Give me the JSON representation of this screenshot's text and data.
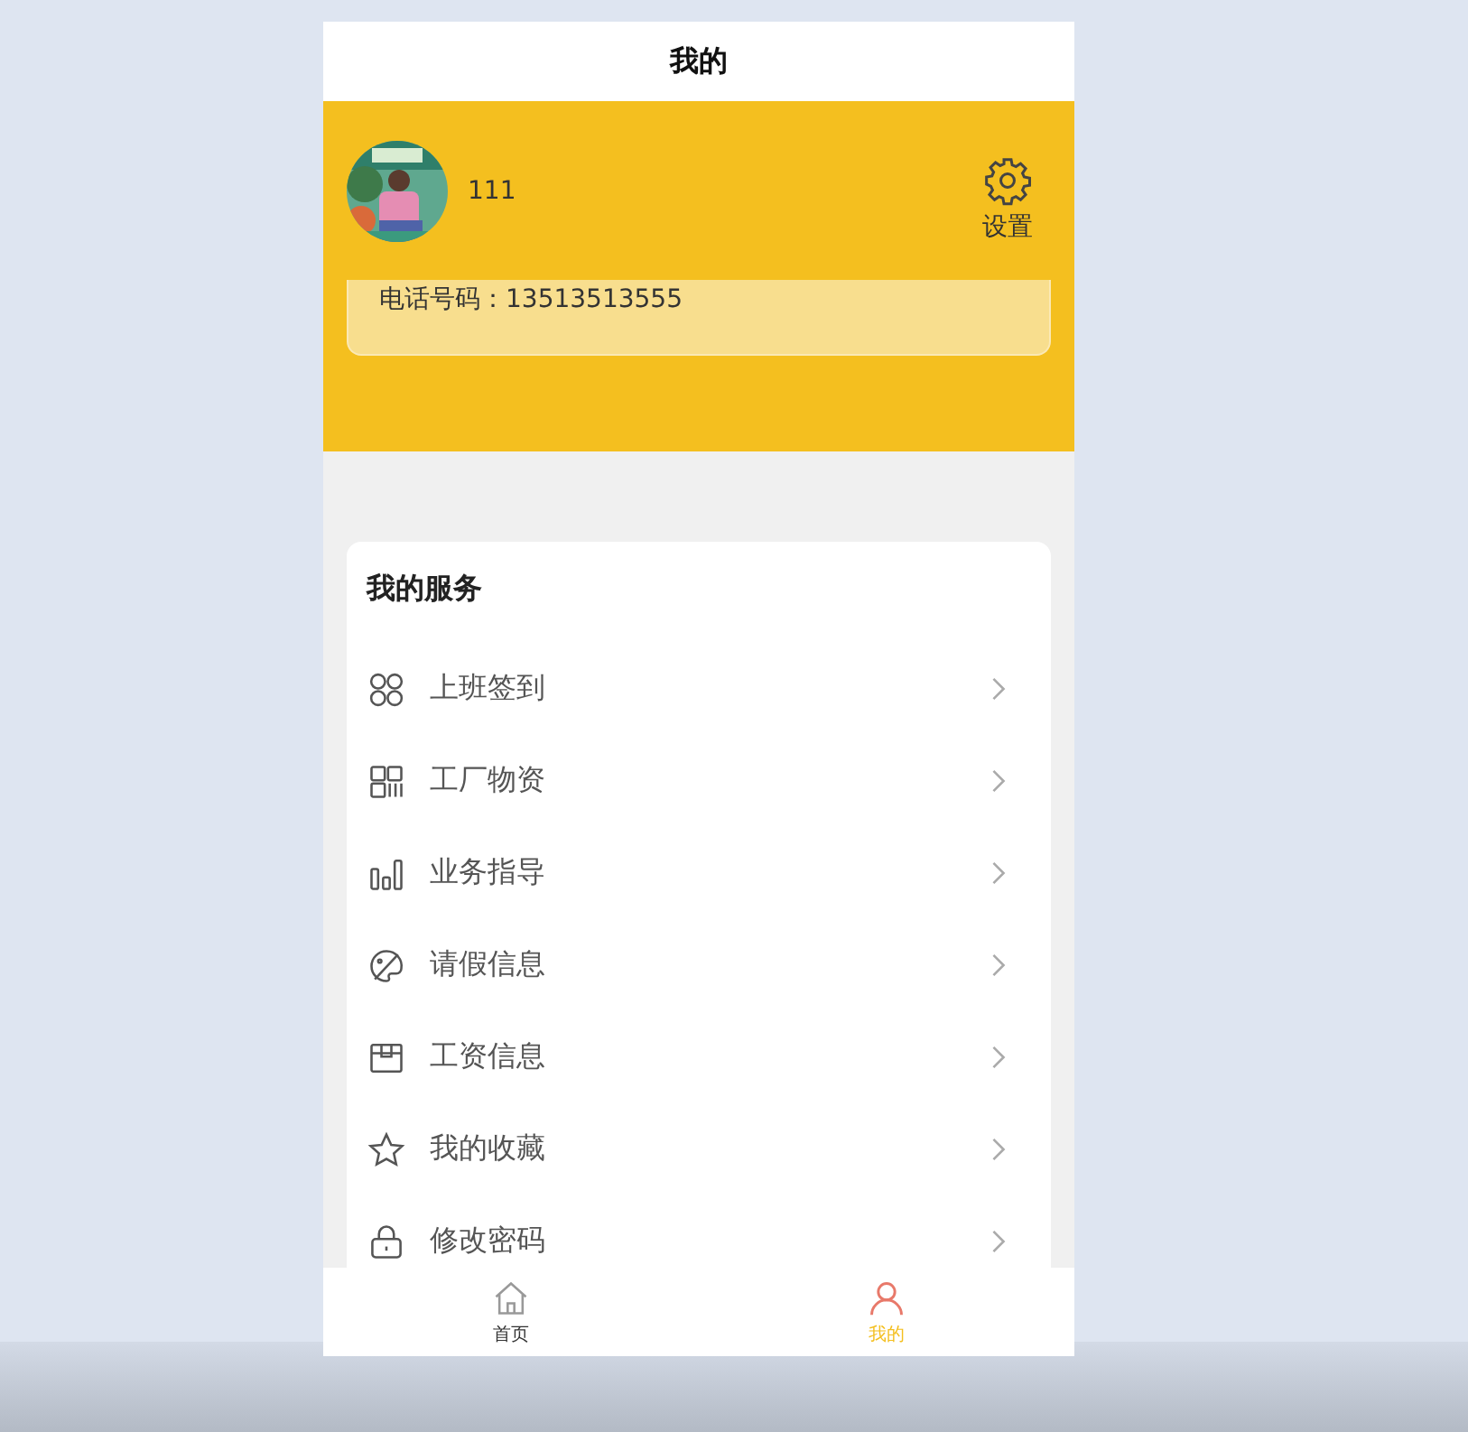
{
  "header": {
    "title": "我的"
  },
  "profile": {
    "name": "111",
    "settings_label": "设置",
    "phone": "电话号码：13513513555"
  },
  "services": {
    "title": "我的服务",
    "items": [
      {
        "kind": "circles",
        "label": "上班签到"
      },
      {
        "kind": "grid",
        "label": "工厂物资"
      },
      {
        "kind": "bars",
        "label": "业务指导"
      },
      {
        "kind": "palette",
        "label": "请假信息"
      },
      {
        "kind": "box",
        "label": "工资信息"
      },
      {
        "kind": "star",
        "label": "我的收藏"
      },
      {
        "kind": "lock",
        "label": "修改密码"
      }
    ]
  },
  "tab_bar": [
    {
      "kind": "home",
      "label": "首页",
      "selected": false
    },
    {
      "kind": "person",
      "label": "我的",
      "selected": true
    }
  ]
}
